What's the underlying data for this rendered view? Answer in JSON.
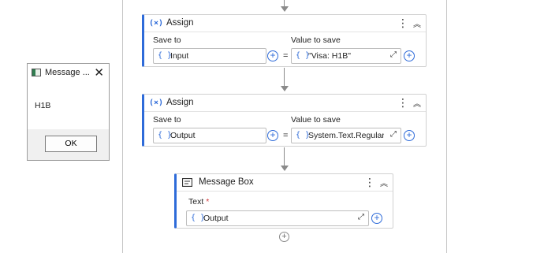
{
  "dialog": {
    "title": "Message ...",
    "message": "H1B",
    "ok_label": "OK",
    "close_glyph": "✕",
    "app_icon": "window-app-icon"
  },
  "activities": [
    {
      "type": "assign",
      "icon_text": "(×)",
      "title": "Assign",
      "save_to_label": "Save to",
      "value_label": "Value to save",
      "save_to_value": "Input",
      "value_value": "\"Visa: H1B\"",
      "equals": "="
    },
    {
      "type": "assign",
      "icon_text": "(×)",
      "title": "Assign",
      "save_to_label": "Save to",
      "value_label": "Value to save",
      "save_to_value": "Output",
      "value_value": "System.Text.RegularEx",
      "equals": "="
    },
    {
      "type": "message-box",
      "icon_name": "message-box-icon",
      "title": "Message Box",
      "text_label": "Text",
      "required_mark": "*",
      "text_value": "Output"
    }
  ],
  "common": {
    "brace": "{ }",
    "kebab": "⋮",
    "collapse": "︽",
    "expand": "⤢",
    "plus": "+"
  },
  "colors": {
    "accent": "#2e6bd9",
    "connector": "#8a8a8a",
    "required": "#d13438"
  }
}
